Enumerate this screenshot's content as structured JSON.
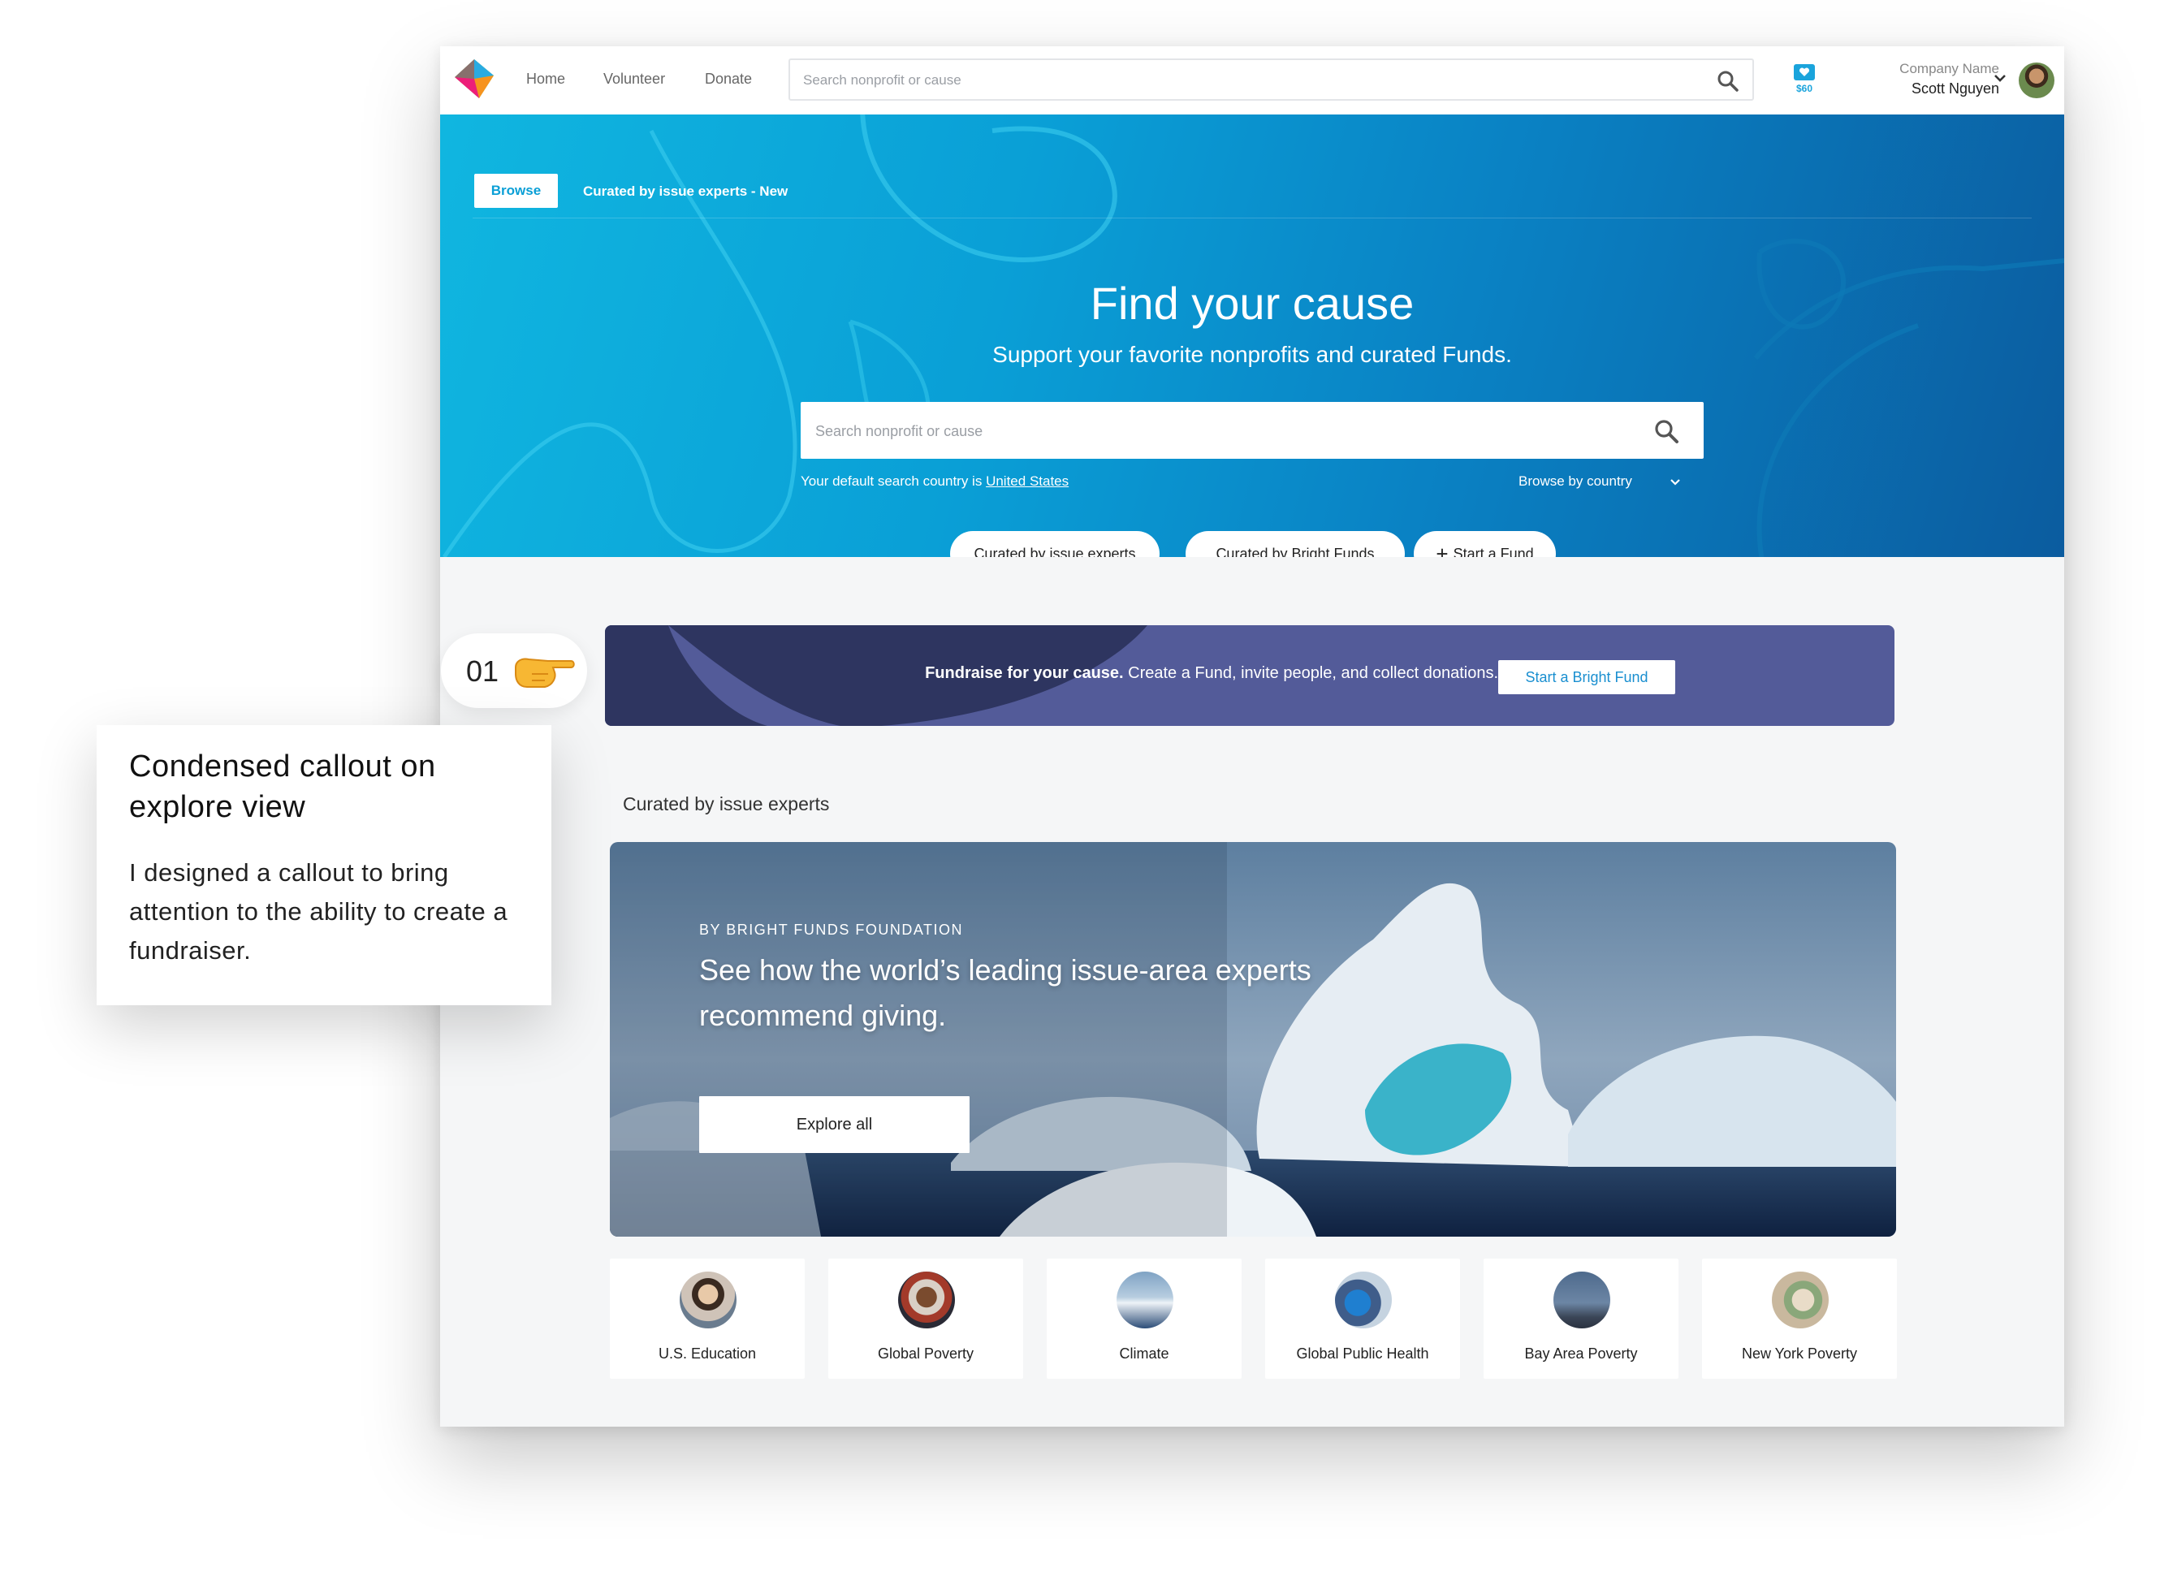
{
  "nav": {
    "links": [
      "Home",
      "Volunteer",
      "Donate"
    ],
    "search_placeholder": "Search nonprofit or cause",
    "wallet_amount": "$60",
    "company_name": "Company Name",
    "user_name": "Scott Nguyen"
  },
  "hero": {
    "tab_browse": "Browse",
    "tab_curated": "Curated by issue experts - New",
    "title": "Find your cause",
    "subtitle": "Support your favorite nonprofits and curated Funds.",
    "search_placeholder": "Search nonprofit or cause",
    "default_country_prefix": "Your default search country is",
    "default_country": "United States",
    "browse_country": "Browse by country",
    "pills": [
      "Curated by issue experts",
      "Curated by Bright Funds",
      "Start a Fund"
    ]
  },
  "banner": {
    "bold": "Fundraise for your cause.",
    "text": " Create a Fund, invite people, and collect donations.",
    "button": "Start a Bright Fund"
  },
  "curated": {
    "section_title": "Curated by issue experts",
    "org": "BY BRIGHT FUNDS FOUNDATION",
    "headline": "See how the world’s leading issue-area experts recommend giving.",
    "button": "Explore all"
  },
  "categories": [
    {
      "label": "U.S. Education"
    },
    {
      "label": "Global Poverty"
    },
    {
      "label": "Climate"
    },
    {
      "label": "Global Public Health"
    },
    {
      "label": "Bay Area Poverty"
    },
    {
      "label": "New York Poverty"
    }
  ],
  "annotation": {
    "step": "01",
    "title": "Condensed callout on explore view",
    "body": "I designed a callout to bring attention to the ability to create a fundraiser."
  },
  "colors": {
    "brand_blue": "#0a9fd6",
    "banner_purple": "#535b99",
    "banner_dark": "#2e3560"
  }
}
